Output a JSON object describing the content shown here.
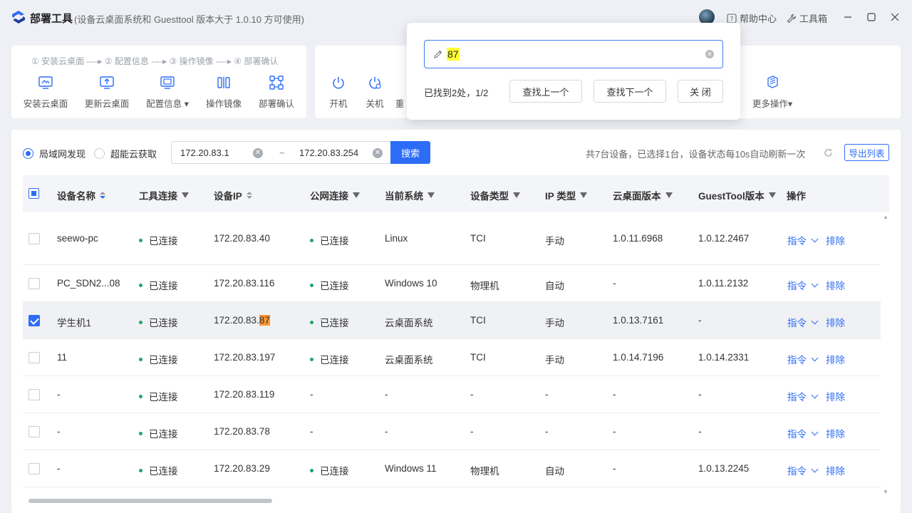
{
  "app": {
    "name": "部署工具",
    "subtitle": "(设备云桌面系统和 Guesttool 版本大于 1.0.10 方可使用)",
    "help": "帮助中心",
    "toolbox": "工具箱"
  },
  "steps": "① 安装云桌面 ----▸ ② 配置信息 ----▸ ③ 操作镜像 ----▸ ④ 部署确认",
  "tools_left": [
    {
      "label": "安装云桌面",
      "icon": "install-desktop-icon"
    },
    {
      "label": "更新云桌面",
      "icon": "update-desktop-icon"
    },
    {
      "label": "配置信息",
      "icon": "config-info-icon"
    },
    {
      "label": "操作镜像",
      "icon": "mirror-image-icon"
    },
    {
      "label": "部署确认",
      "icon": "deploy-confirm-icon"
    }
  ],
  "tools_right": [
    {
      "label": "开机",
      "icon": "power-on-icon"
    },
    {
      "label": "关机",
      "icon": "power-off-icon"
    },
    {
      "label": "重",
      "icon": "restart-icon"
    },
    {
      "label": "更多操作",
      "icon": "more-ops-icon"
    }
  ],
  "find": {
    "value": "87",
    "result": "已找到2处，1/2",
    "prev": "查找上一个",
    "next": "查找下一个",
    "close": "关 闭"
  },
  "filter": {
    "radio_lan": "局域网发现",
    "radio_cloud": "超能云获取",
    "ip_start": "172.20.83.1",
    "tilde": "~",
    "ip_end": "172.20.83.254",
    "search": "搜索",
    "summary": "共7台设备，已选择1台，设备状态每10s自动刷新一次",
    "export": "导出列表"
  },
  "columns": {
    "name": "设备名称",
    "tool": "工具连接",
    "ip": "设备IP",
    "public": "公网连接",
    "os": "当前系统",
    "type": "设备类型",
    "iptype": "IP 类型",
    "cloud": "云桌面版本",
    "guest": "GuestTool版本",
    "ops": "操作"
  },
  "rows": [
    {
      "name": "seewo-pc",
      "tool": "已连接",
      "ip_a": "172.20.83.40",
      "ip_b": "",
      "public": "已连接",
      "os": "Linux",
      "type": "TCI",
      "iptype": "手动",
      "cloud": "1.0.11.6968",
      "guest": "1.0.12.2467",
      "cmd": "指令",
      "remove": "排除",
      "checked": false
    },
    {
      "name": "PC_SDN2...08",
      "tool": "已连接",
      "ip_a": "172.20.83.116",
      "ip_b": "",
      "public": "已连接",
      "os": "Windows 10",
      "type": "物理机",
      "iptype": "自动",
      "cloud": "-",
      "guest": "1.0.11.2132",
      "cmd": "指令",
      "remove": "排除",
      "checked": false
    },
    {
      "name": "学生机1",
      "tool": "已连接",
      "ip_a": "172.20.83.",
      "ip_b": "87",
      "public": "已连接",
      "os": "云桌面系统",
      "type": "TCI",
      "iptype": "手动",
      "cloud": "1.0.13.7161",
      "guest": "-",
      "cmd": "指令",
      "remove": "排除",
      "checked": true
    },
    {
      "name": "11",
      "tool": "已连接",
      "ip_a": "172.20.83.197",
      "ip_b": "",
      "public": "已连接",
      "os": "云桌面系统",
      "type": "TCI",
      "iptype": "手动",
      "cloud": "1.0.14.7196",
      "guest": "1.0.14.2331",
      "cmd": "指令",
      "remove": "排除",
      "checked": false
    },
    {
      "name": "-",
      "tool": "已连接",
      "ip_a": "172.20.83.119",
      "ip_b": "",
      "public": "-",
      "os": "-",
      "type": "-",
      "iptype": "-",
      "cloud": "-",
      "guest": "-",
      "cmd": "指令",
      "remove": "排除",
      "checked": false
    },
    {
      "name": "-",
      "tool": "已连接",
      "ip_a": "172.20.83.78",
      "ip_b": "",
      "public": "-",
      "os": "-",
      "type": "-",
      "iptype": "-",
      "cloud": "-",
      "guest": "-",
      "cmd": "指令",
      "remove": "排除",
      "checked": false
    },
    {
      "name": "-",
      "tool": "已连接",
      "ip_a": "172.20.83.29",
      "ip_b": "",
      "public": "已连接",
      "os": "Windows 11",
      "type": "物理机",
      "iptype": "自动",
      "cloud": "-",
      "guest": "1.0.13.2245",
      "cmd": "指令",
      "remove": "排除",
      "checked": false
    }
  ],
  "colors": {
    "accent": "#2d6df6",
    "online": "#21a366",
    "find_highlight": "#ffff33",
    "match_highlight": "#ff9632"
  }
}
